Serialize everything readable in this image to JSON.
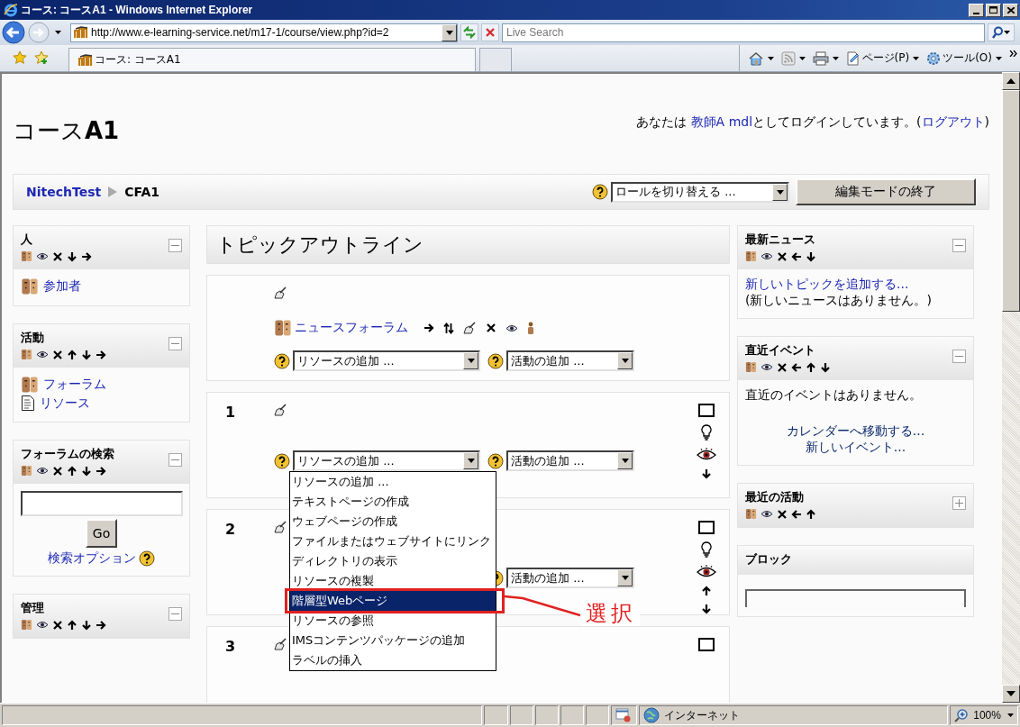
{
  "browser": {
    "title": "コース: コースA1 - Windows Internet Explorer",
    "address": "http://www.e-learning-service.net/m17-1/course/view.php?id=2",
    "search_placeholder": "Live Search",
    "tabs": [
      {
        "label": "コース: コースA1",
        "selected": true
      }
    ],
    "commands": [
      {
        "kind": "home"
      },
      {
        "kind": "feeds"
      },
      {
        "kind": "print"
      },
      {
        "kind": "page",
        "label": "ページ(P)"
      },
      {
        "kind": "tools",
        "label": "ツール(O)"
      }
    ]
  },
  "page": {
    "course_title": "コース**A1**",
    "login": {
      "before": "あなたは ",
      "user": "教師A mdl",
      "middle": "としてログインしています。(",
      "logout": "ログアウト",
      "after": ")"
    },
    "breadcrumb": [
      {
        "label": "NitechTest",
        "kind": "link"
      },
      {
        "label": "CFA1",
        "kind": "current"
      }
    ],
    "role_select": "ロールを切り替える ...",
    "edit_button": "編集モードの終了",
    "left_blocks": [
      {
        "title": "人",
        "collapsed": false,
        "controls": [
          {
            "kind": "roles"
          },
          {
            "kind": "hide"
          },
          {
            "kind": "delete"
          },
          {
            "kind": "down"
          },
          {
            "kind": "right"
          }
        ],
        "kind": "links",
        "items": [
          {
            "label": "参加者",
            "kind": "people"
          }
        ]
      },
      {
        "title": "活動",
        "collapsed": false,
        "controls": [
          {
            "kind": "roles"
          },
          {
            "kind": "hide"
          },
          {
            "kind": "delete"
          },
          {
            "kind": "up"
          },
          {
            "kind": "down"
          },
          {
            "kind": "right"
          }
        ],
        "kind": "links",
        "items": [
          {
            "label": "フォーラム",
            "kind": "forum"
          },
          {
            "label": "リソース",
            "kind": "resource"
          }
        ]
      },
      {
        "title": "フォーラムの検索",
        "collapsed": false,
        "controls": [
          {
            "kind": "roles"
          },
          {
            "kind": "hide"
          },
          {
            "kind": "delete"
          },
          {
            "kind": "up"
          },
          {
            "kind": "down"
          },
          {
            "kind": "right"
          }
        ],
        "kind": "search",
        "button": "Go",
        "link": "検索オプション"
      },
      {
        "title": "管理",
        "collapsed": false,
        "controls": [
          {
            "kind": "roles"
          },
          {
            "kind": "hide"
          },
          {
            "kind": "delete"
          },
          {
            "kind": "up"
          },
          {
            "kind": "down"
          },
          {
            "kind": "right"
          }
        ]
      }
    ],
    "outline": {
      "title": "トピックアウトライン",
      "sections": [
        {
          "activities": [
            {
              "label": "ニュースフォーラム",
              "kind": "forum",
              "controls": [
                {
                  "kind": "right"
                },
                {
                  "kind": "move"
                },
                {
                  "kind": "edit"
                },
                {
                  "kind": "delete"
                },
                {
                  "kind": "hide"
                },
                {
                  "kind": "group"
                }
              ]
            }
          ],
          "resource_select": "リソースの追加 ...",
          "activity_select": "活動の追加 ..."
        },
        {
          "number": "1",
          "resource_select": "リソースの追加 ...",
          "activity_select": "活動の追加 ...",
          "side_controls": [
            {
              "kind": "show-only"
            },
            {
              "kind": "highlight"
            },
            {
              "kind": "hide"
            },
            {
              "kind": "down"
            }
          ],
          "open_list": {
            "callout": "選択",
            "options": [
              {
                "label": "リソースの追加 ...",
                "selected": false
              },
              {
                "label": "テキストページの作成",
                "selected": false
              },
              {
                "label": "ウェブページの作成",
                "selected": false
              },
              {
                "label": "ファイルまたはウェブサイトにリンク",
                "selected": false
              },
              {
                "label": "ディレクトリの表示",
                "selected": false
              },
              {
                "label": "リソースの複製",
                "selected": false
              },
              {
                "label": "階層型Webページ",
                "selected": true
              },
              {
                "label": "リソースの参照",
                "selected": false
              },
              {
                "label": "IMSコンテンツパッケージの追加",
                "selected": false
              },
              {
                "label": "ラベルの挿入",
                "selected": false
              }
            ]
          }
        },
        {
          "number": "2",
          "activity_select": "活動の追加 ...",
          "side_controls": [
            {
              "kind": "show-only"
            },
            {
              "kind": "highlight"
            },
            {
              "kind": "hide"
            },
            {
              "kind": "up"
            },
            {
              "kind": "down"
            }
          ]
        },
        {
          "number": "3",
          "side_controls": [
            {
              "kind": "show-only"
            }
          ]
        }
      ]
    },
    "right_blocks": [
      {
        "title": "最新ニュース",
        "collapsed": false,
        "controls": [
          {
            "kind": "roles"
          },
          {
            "kind": "hide"
          },
          {
            "kind": "delete"
          },
          {
            "kind": "left"
          },
          {
            "kind": "down"
          }
        ],
        "kind": "news",
        "link": "新しいトピックを追加する...",
        "text": "(新しいニュースはありません。)"
      },
      {
        "title": "直近イベント",
        "collapsed": false,
        "controls": [
          {
            "kind": "roles"
          },
          {
            "kind": "hide"
          },
          {
            "kind": "delete"
          },
          {
            "kind": "left"
          },
          {
            "kind": "up"
          },
          {
            "kind": "down"
          }
        ],
        "kind": "events",
        "text": "直近のイベントはありません。",
        "links": [
          "カレンダーへ移動する...",
          "新しいイベント..."
        ]
      },
      {
        "title": "最近の活動",
        "collapsed": true,
        "controls": [
          {
            "kind": "roles"
          },
          {
            "kind": "hide"
          },
          {
            "kind": "delete"
          },
          {
            "kind": "left"
          },
          {
            "kind": "up"
          }
        ]
      },
      {
        "title": "ブロック",
        "kind": "select"
      }
    ]
  },
  "status_bar": {
    "zone": "インターネット",
    "zoom": "100%"
  }
}
